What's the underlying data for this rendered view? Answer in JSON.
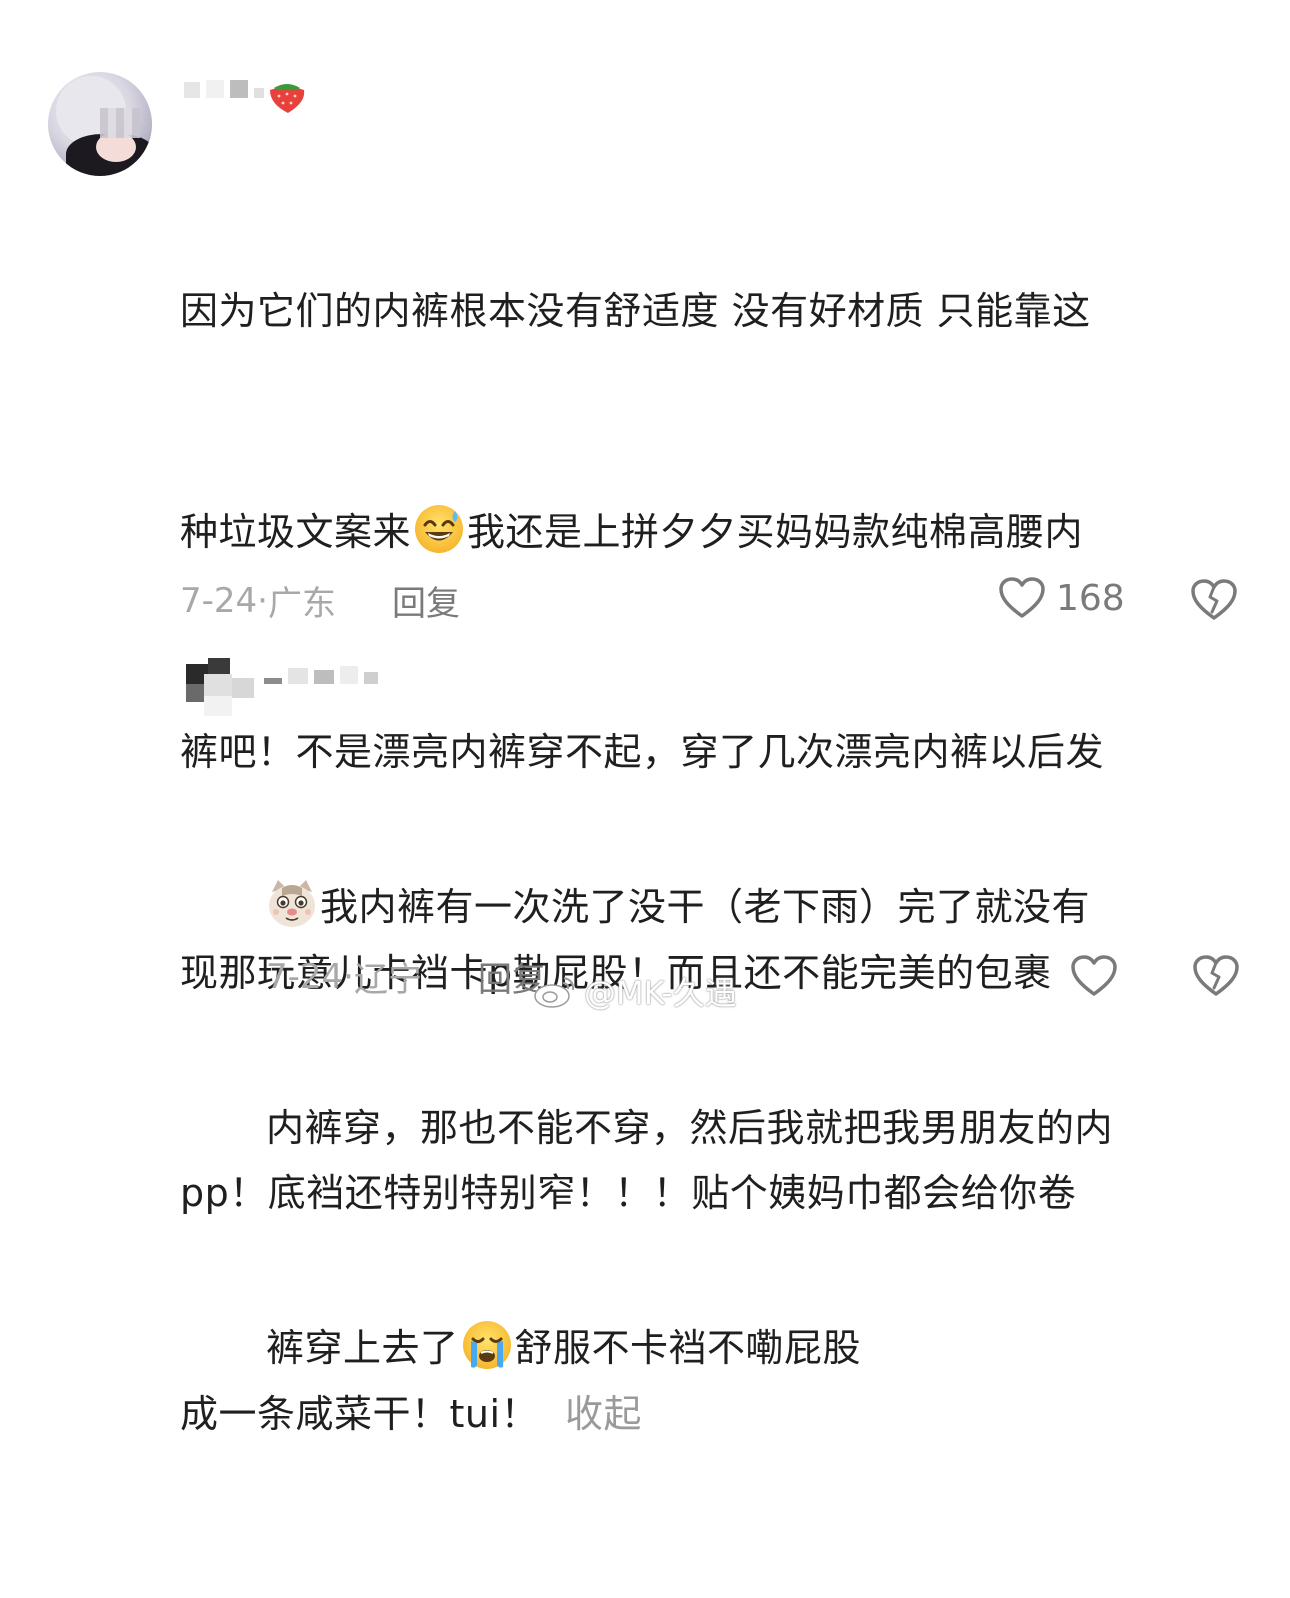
{
  "comments": [
    {
      "lines": [
        "因为它们的内裤根本没有舒适度 没有好材质 只能靠这",
        "种垃圾文案来",
        "我还是上拼夕夕买妈妈款纯棉高腰内",
        "裤吧！不是漂亮内裤穿不起，穿了几次漂亮内裤以后发",
        "现那玩意儿卡裆卡p勒屁股！而且还不能完美的包裹",
        "pp！底裆还特别特别窄！！！贴个姨妈巾都会给你卷",
        "成一条咸菜干！tui！"
      ],
      "collapse_label": "收起",
      "date": "7-24",
      "location": "广东",
      "reply_label": "回复",
      "like_count": "168",
      "emoji_icon": "grinning-sweat-emoji-icon"
    },
    {
      "lines": [
        "我内裤有一次洗了没干（老下雨）完了就没有",
        "内裤穿，那也不能不穿，然后我就把我男朋友的内",
        "裤穿上去了",
        "舒服不卡裆不嘞屁股"
      ],
      "date": "7-24",
      "location": "辽宁",
      "reply_label": "回复",
      "emoji_icons": [
        "cat-face-emoji-icon",
        "crying-face-emoji-icon"
      ]
    }
  ],
  "watermark": {
    "text": "@MK-久遇",
    "icon": "weibo-icon"
  },
  "colors": {
    "text": "#1f1f1f",
    "muted": "#a8a8a8",
    "secondary": "#7a7a7a",
    "collapse": "#9a9a9a"
  }
}
